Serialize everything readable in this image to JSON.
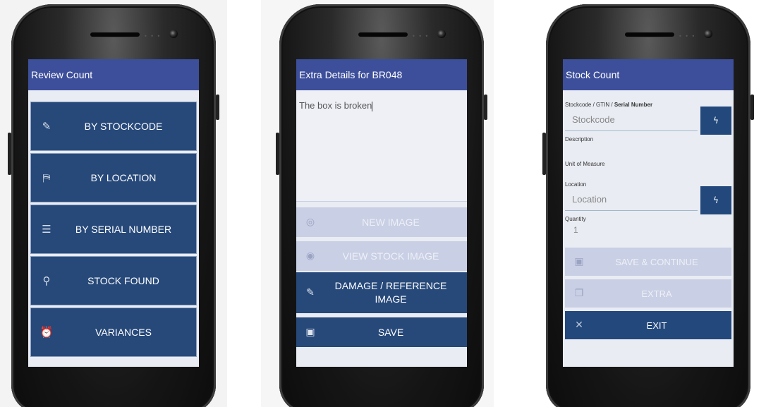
{
  "screen1": {
    "title": "Review Count",
    "items": [
      {
        "icon": "pencil-icon",
        "glyph": "✎",
        "label": "BY STOCKCODE"
      },
      {
        "icon": "map-icon",
        "glyph": "⛿",
        "label": "BY LOCATION"
      },
      {
        "icon": "list-icon",
        "glyph": "☰",
        "label": "BY SERIAL NUMBER"
      },
      {
        "icon": "search-icon",
        "glyph": "⚲",
        "label": "STOCK FOUND"
      },
      {
        "icon": "alarm-icon",
        "glyph": "⏰",
        "label": "VARIANCES"
      }
    ]
  },
  "screen2": {
    "title": "Extra Details for BR048",
    "note_text": "The box is broken",
    "buttons": [
      {
        "icon": "camera-icon",
        "glyph": "◎",
        "label": "NEW IMAGE",
        "enabled": false
      },
      {
        "icon": "eye-icon",
        "glyph": "◉",
        "label": "VIEW STOCK IMAGE",
        "enabled": false
      },
      {
        "icon": "pencil-icon",
        "glyph": "✎",
        "label_line1": "DAMAGE / REFERENCE",
        "label_line2": "IMAGE",
        "enabled": true
      },
      {
        "icon": "floppy-icon",
        "glyph": "▣",
        "label": "SAVE",
        "enabled": true
      }
    ]
  },
  "screen3": {
    "title": "Stock Count",
    "stockcode_label_prefix": "Stockcode / GTIN / ",
    "stockcode_label_bold": "Serial Number",
    "stockcode_placeholder": "Stockcode",
    "description_label": "Description",
    "uom_label": "Unit of Measure",
    "location_label": "Location",
    "location_placeholder": "Location",
    "quantity_label": "Quantity",
    "quantity_value": "1",
    "scan_glyph": "ϟ",
    "buttons": [
      {
        "icon": "floppy-icon",
        "glyph": "▣",
        "label": "SAVE & CONTINUE",
        "enabled": false
      },
      {
        "icon": "clipboard-icon",
        "glyph": "❐",
        "label": "EXTRA",
        "enabled": false
      },
      {
        "icon": "close-icon",
        "glyph": "✕",
        "label": "EXIT",
        "enabled": true
      }
    ]
  },
  "colors": {
    "appbar": "#3d4f9b",
    "button_dark": "#27497a",
    "button_disabled": "#c9cfe4",
    "screen_bg": "#e9ecf3"
  }
}
